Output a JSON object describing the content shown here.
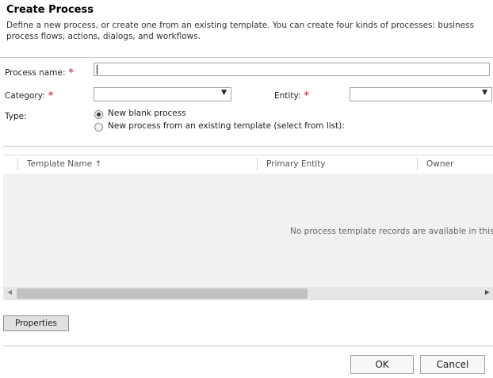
{
  "dialog": {
    "title": "Create Process",
    "description": "Define a new process, or create one from an existing template. You can create four kinds of processes: business process flows, actions, dialogs, and workflows."
  },
  "form": {
    "process_name_label": "Process name:",
    "process_name_value": "",
    "category_label": "Category:",
    "category_value": "",
    "entity_label": "Entity:",
    "entity_value": "",
    "required_marker": "*",
    "type_label": "Type:",
    "type_options": [
      {
        "label": "New blank process",
        "checked": true
      },
      {
        "label": "New process from an existing template (select from list):",
        "checked": false
      }
    ]
  },
  "grid": {
    "columns": [
      {
        "label": "Template Name",
        "sort": "ascending"
      },
      {
        "label": "Primary Entity"
      },
      {
        "label": "Owner"
      }
    ],
    "sort_icon": "↑",
    "empty_message": "No process template records are available in this view."
  },
  "buttons": {
    "properties": "Properties",
    "ok": "OK",
    "cancel": "Cancel"
  },
  "icons": {
    "dropdown": "▼",
    "scroll_left": "◀",
    "scroll_right": "▶"
  }
}
